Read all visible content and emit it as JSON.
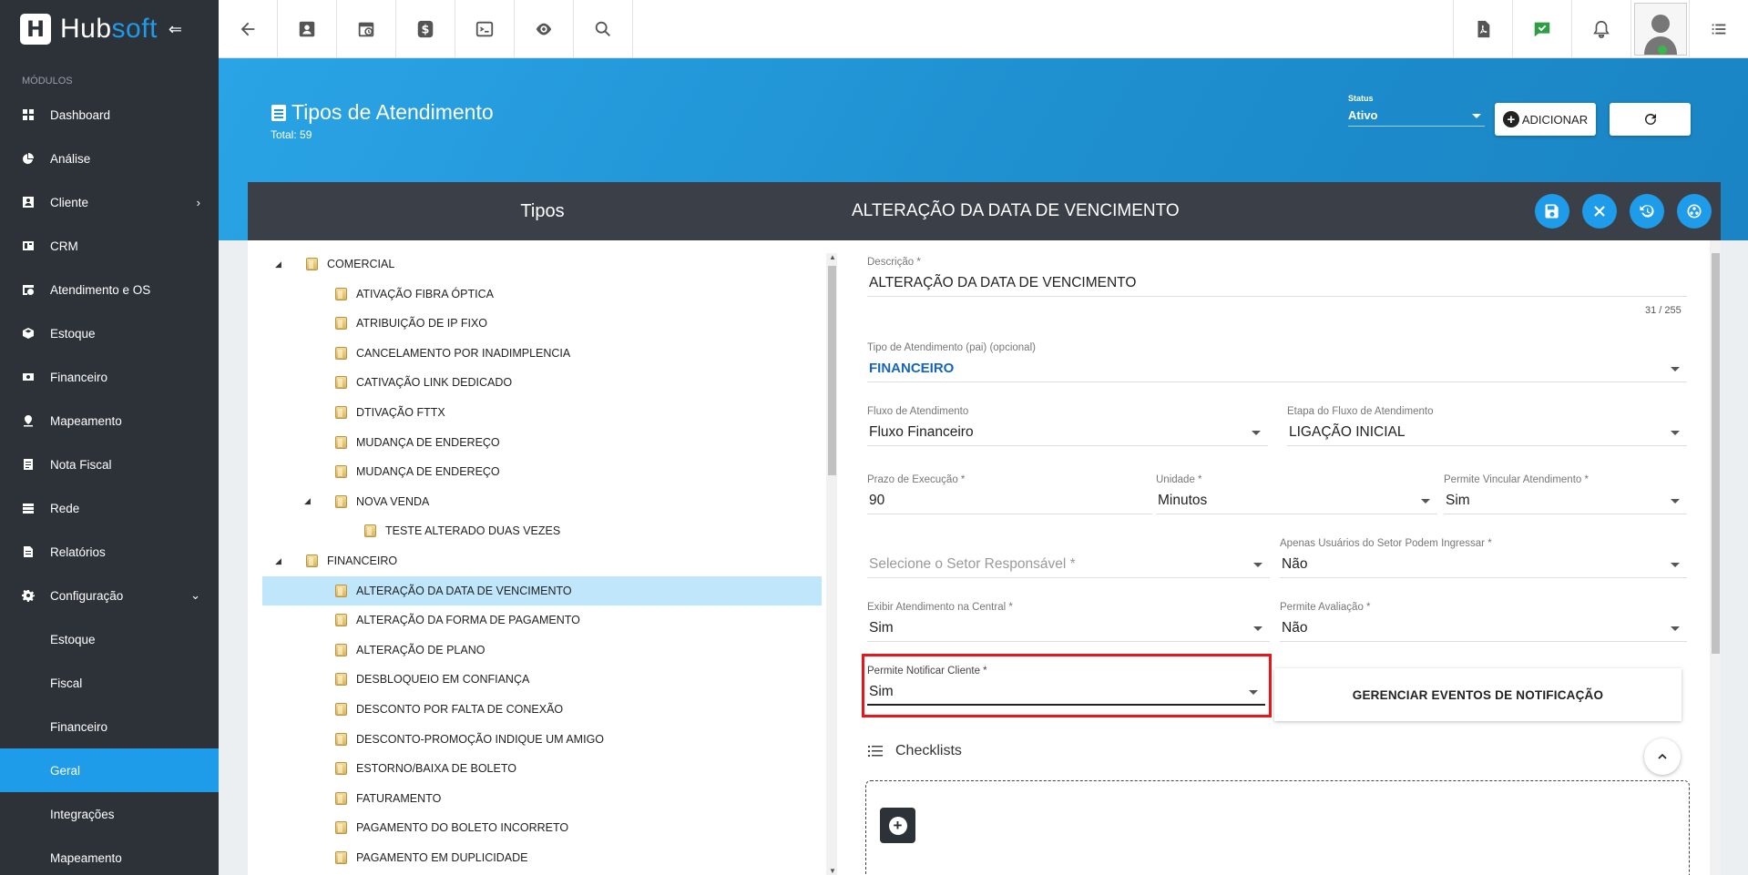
{
  "app": {
    "brand_a": "Hub",
    "brand_b": "soft",
    "accent": "#1e9be9"
  },
  "sidebar": {
    "modules_label": "MÓDULOS",
    "items": [
      {
        "label": "Dashboard",
        "icon": "dashboard-icon"
      },
      {
        "label": "Análise",
        "icon": "pie-chart-icon"
      },
      {
        "label": "Cliente",
        "icon": "contact-card-icon",
        "chevron": "›"
      },
      {
        "label": "CRM",
        "icon": "crm-icon"
      },
      {
        "label": "Atendimento e OS",
        "icon": "calendar-clock-icon"
      },
      {
        "label": "Estoque",
        "icon": "box-icon"
      },
      {
        "label": "Financeiro",
        "icon": "money-icon"
      },
      {
        "label": "Mapeamento",
        "icon": "map-pin-icon"
      },
      {
        "label": "Nota Fiscal",
        "icon": "invoice-icon"
      },
      {
        "label": "Rede",
        "icon": "server-icon"
      },
      {
        "label": "Relatórios",
        "icon": "report-icon"
      },
      {
        "label": "Configuração",
        "icon": "gear-icon",
        "chevron": "⌄"
      }
    ],
    "subitems": [
      "Estoque",
      "Fiscal",
      "Financeiro",
      "Geral",
      "Integrações",
      "Mapeamento"
    ],
    "active_sub": "Geral"
  },
  "page": {
    "title": "Tipos de Atendimento",
    "total": "Total: 59",
    "status_label": "Status",
    "status_value": "Ativo",
    "add_label": "ADICIONAR"
  },
  "tree": {
    "header": "Tipos",
    "nodes": [
      {
        "label": "COMERCIAL",
        "level": 0,
        "expanded": true
      },
      {
        "label": "ATIVAÇÃO FIBRA ÓPTICA",
        "level": 1
      },
      {
        "label": "ATRIBUIÇÃO DE IP FIXO",
        "level": 1
      },
      {
        "label": "CANCELAMENTO POR INADIMPLENCIA",
        "level": 1
      },
      {
        "label": "CATIVAÇÃO LINK DEDICADO",
        "level": 1
      },
      {
        "label": "DTIVAÇÃO FTTX",
        "level": 1
      },
      {
        "label": "MUDANÇA DE ENDEREÇO",
        "level": 1
      },
      {
        "label": "MUDANÇA DE ENDEREÇO",
        "level": 1
      },
      {
        "label": "NOVA VENDA",
        "level": 1,
        "expanded": true
      },
      {
        "label": "TESTE ALTERADO DUAS VEZES",
        "level": 2
      },
      {
        "label": "FINANCEIRO",
        "level": 0,
        "expanded": true
      },
      {
        "label": "ALTERAÇÃO DA DATA DE VENCIMENTO",
        "level": 1,
        "selected": true
      },
      {
        "label": "ALTERAÇÃO DA FORMA DE PAGAMENTO",
        "level": 1
      },
      {
        "label": "ALTERAÇÃO DE PLANO",
        "level": 1
      },
      {
        "label": "DESBLOQUEIO EM CONFIANÇA",
        "level": 1
      },
      {
        "label": "DESCONTO POR FALTA DE CONEXÃO",
        "level": 1
      },
      {
        "label": "DESCONTO-PROMOÇÃO INDIQUE UM AMIGO",
        "level": 1
      },
      {
        "label": "ESTORNO/BAIXA DE BOLETO",
        "level": 1
      },
      {
        "label": "FATURAMENTO",
        "level": 1
      },
      {
        "label": "PAGAMENTO DO BOLETO INCORRETO",
        "level": 1
      },
      {
        "label": "PAGAMENTO EM DUPLICIDADE",
        "level": 1
      }
    ]
  },
  "form": {
    "header": "ALTERAÇÃO DA DATA DE VENCIMENTO",
    "descricao_label": "Descrição *",
    "descricao_value": "ALTERAÇÃO DA DATA DE VENCIMENTO",
    "descricao_counter": "31 / 255",
    "tipo_pai_label": "Tipo de Atendimento (pai) (opcional)",
    "tipo_pai_value": "FINANCEIRO",
    "fluxo_label": "Fluxo de Atendimento",
    "fluxo_value": "Fluxo Financeiro",
    "etapa_label": "Etapa do Fluxo de Atendimento",
    "etapa_value": "LIGAÇÃO INICIAL",
    "prazo_label": "Prazo de Execução *",
    "prazo_value": "90",
    "unidade_label": "Unidade *",
    "unidade_value": "Minutos",
    "vincular_label": "Permite Vincular Atendimento *",
    "vincular_value": "Sim",
    "setor_placeholder": "Selecione o Setor Responsável *",
    "apenas_label": "Apenas Usuários do Setor Podem Ingressar *",
    "apenas_value": "Não",
    "exibir_label": "Exibir Atendimento na Central *",
    "exibir_value": "Sim",
    "avaliacao_label": "Permite Avaliação *",
    "avaliacao_value": "Não",
    "notificar_label": "Permite Notificar Cliente *",
    "notificar_value": "Sim",
    "notif_button": "GERENCIAR EVENTOS DE NOTIFICAÇÃO",
    "checklists_label": "Checklists",
    "highlight_color": "#e8151b"
  }
}
